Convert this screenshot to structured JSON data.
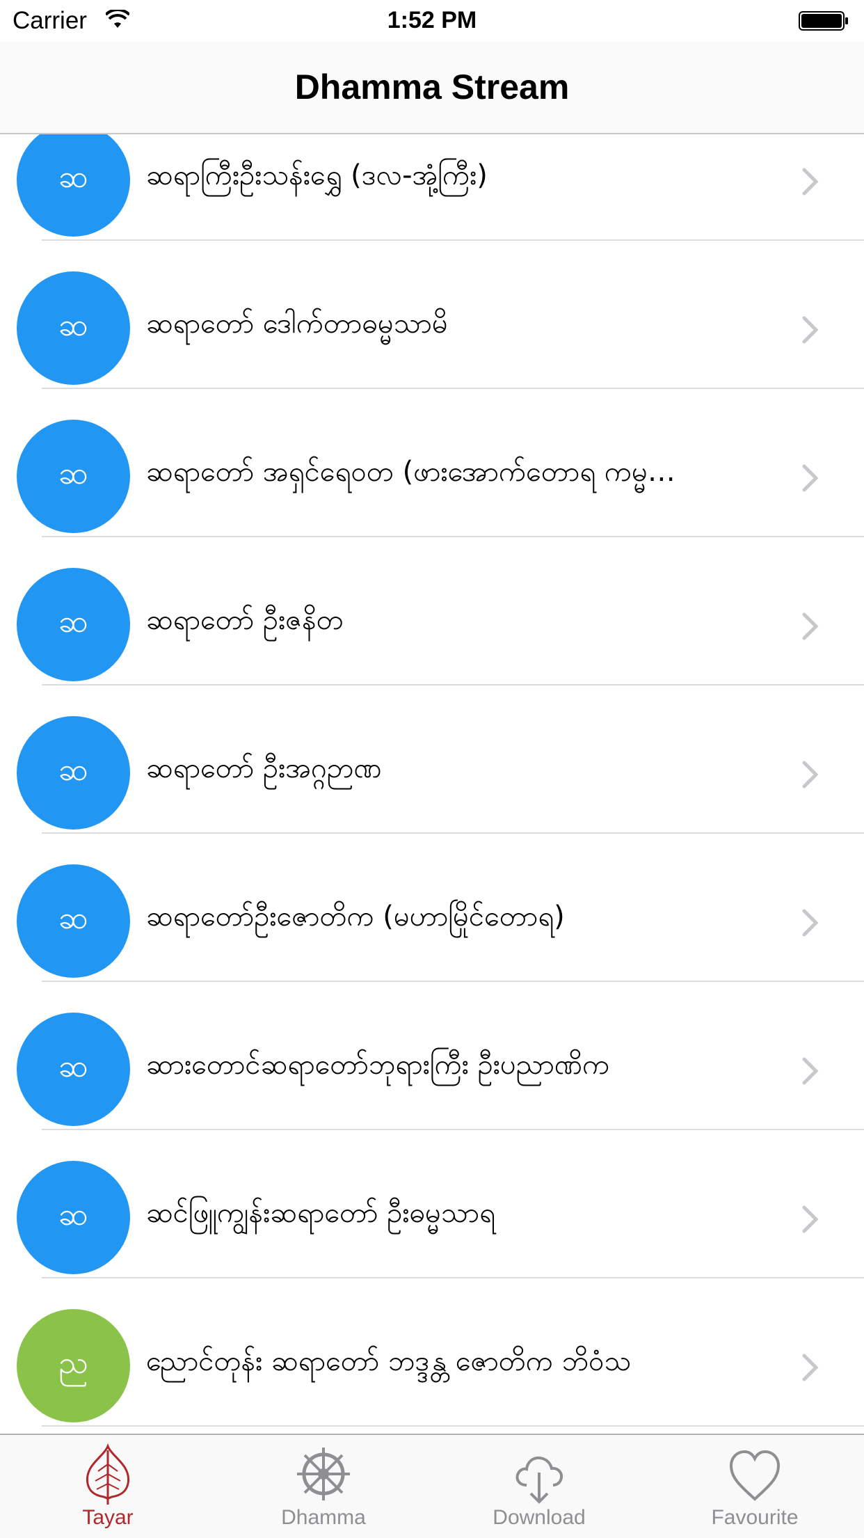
{
  "status_bar": {
    "carrier": "Carrier",
    "time": "1:52 PM"
  },
  "nav": {
    "title": "Dhamma Stream"
  },
  "list": {
    "rows": [
      {
        "initial": "ဆ",
        "title": "ဆရာကြီးဦးသန်းရွှေ (ဒလ-အုံ့ကြီး)",
        "color": "#2196f3"
      },
      {
        "initial": "ဆ",
        "title": "ဆရာတော် ဒေါက်တာဓမ္မသာမိ",
        "color": "#2196f3"
      },
      {
        "initial": "ဆ",
        "title": "ဆရာတော် အရှင်ရေဝတ (ဖားအောက်တောရ ကမ္မ…",
        "color": "#2196f3"
      },
      {
        "initial": "ဆ",
        "title": "ဆရာတော် ဦးဇနိတ",
        "color": "#2196f3"
      },
      {
        "initial": "ဆ",
        "title": "ဆရာတော် ဦးအဂ္ဂဉာဏ",
        "color": "#2196f3"
      },
      {
        "initial": "ဆ",
        "title": "ဆရာတော်ဦးဇောတိက (မဟာမြိုင်တောရ)",
        "color": "#2196f3"
      },
      {
        "initial": "ဆ",
        "title": "ဆားတောင်ဆရာတော်ဘုရားကြီး ဦးပညာဏိက",
        "color": "#2196f3"
      },
      {
        "initial": "ဆ",
        "title": "ဆင်ဖြူကျွန်းဆရာတော် ဦးဓမ္မသာရ",
        "color": "#2196f3"
      },
      {
        "initial": "ည",
        "title": "ညောင်တုန်း ဆရာတော် ဘဒ္ဒန္တ ဇောတိက ဘိဝံသ",
        "color": "#8bc34a"
      }
    ],
    "partial_next_color": "#795548"
  },
  "tab_bar": {
    "tabs": [
      {
        "label": "Tayar",
        "icon": "bodhi-leaf-icon",
        "active": true
      },
      {
        "label": "Dhamma",
        "icon": "dharma-wheel-icon",
        "active": false
      },
      {
        "label": "Download",
        "icon": "cloud-download-icon",
        "active": false
      },
      {
        "label": "Favourite",
        "icon": "heart-icon",
        "active": false
      }
    ],
    "active_color": "#b0282a",
    "inactive_color": "#8e8e93"
  }
}
